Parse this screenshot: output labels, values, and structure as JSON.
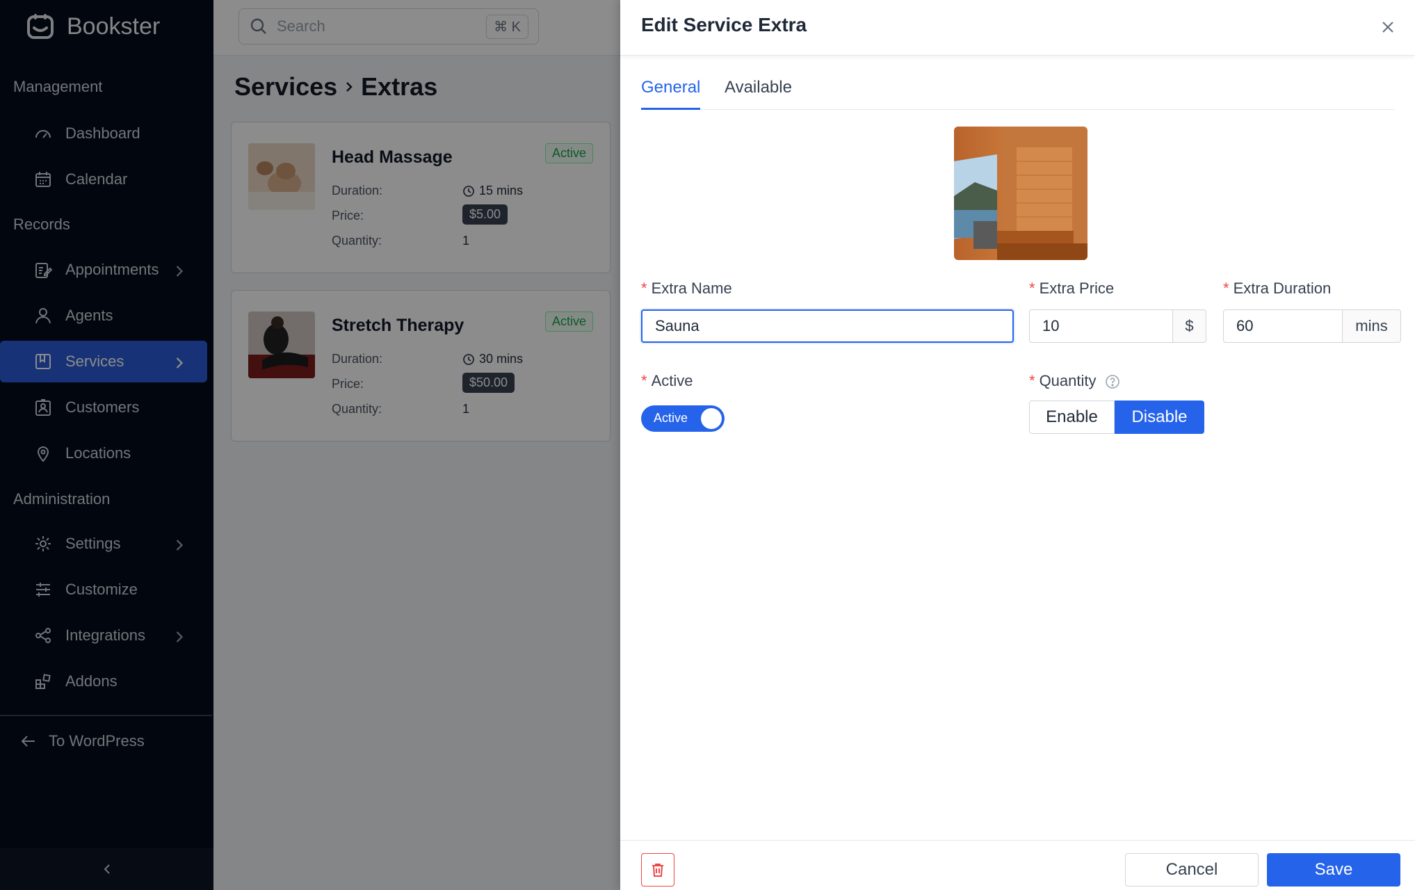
{
  "brand": {
    "name": "Bookster"
  },
  "sidebar": {
    "sections": {
      "management": "Management",
      "records": "Records",
      "administration": "Administration"
    },
    "items": [
      {
        "label": "Dashboard"
      },
      {
        "label": "Calendar"
      },
      {
        "label": "Appointments"
      },
      {
        "label": "Agents"
      },
      {
        "label": "Services"
      },
      {
        "label": "Customers"
      },
      {
        "label": "Locations"
      },
      {
        "label": "Settings"
      },
      {
        "label": "Customize"
      },
      {
        "label": "Integrations"
      },
      {
        "label": "Addons"
      }
    ],
    "to_wordpress": "To WordPress"
  },
  "search": {
    "placeholder": "Search",
    "shortcut": "⌘ K"
  },
  "page": {
    "title_parent": "Services",
    "title_child": "Extras"
  },
  "extras": [
    {
      "name": "Head Massage",
      "status": "Active",
      "duration_label": "Duration:",
      "duration": "15 mins",
      "price_label": "Price:",
      "price": "$5.00",
      "quantity_label": "Quantity:",
      "quantity": "1"
    },
    {
      "name": "Stretch Therapy",
      "status": "Active",
      "duration_label": "Duration:",
      "duration": "30 mins",
      "price_label": "Price:",
      "price": "$50.00",
      "quantity_label": "Quantity:",
      "quantity": "1"
    }
  ],
  "drawer": {
    "title": "Edit Service Extra",
    "tabs": [
      "General",
      "Available"
    ],
    "fields": {
      "name_label": "Extra Name",
      "name_value": "Sauna",
      "price_label": "Extra Price",
      "price_value": "10",
      "price_unit": "$",
      "duration_label": "Extra Duration",
      "duration_value": "60",
      "duration_unit": "mins",
      "active_label": "Active",
      "active_toggle_text": "Active",
      "quantity_label": "Quantity",
      "quantity_enable": "Enable",
      "quantity_disable": "Disable"
    },
    "footer": {
      "cancel": "Cancel",
      "save": "Save"
    }
  },
  "colors": {
    "primary": "#2563eb",
    "sidebar_bg": "#020b1c",
    "active_badge": "#16a34a",
    "danger": "#ef4444"
  }
}
